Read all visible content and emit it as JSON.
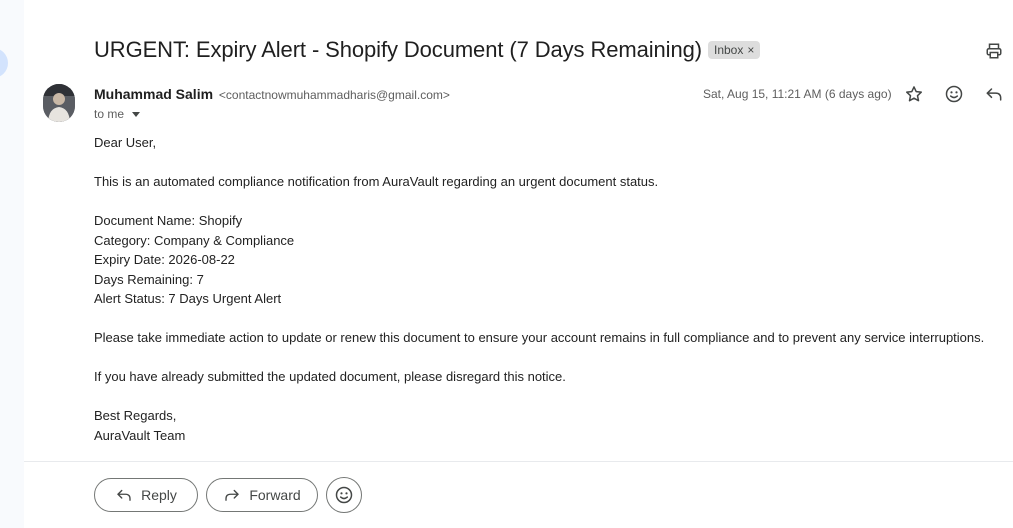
{
  "email": {
    "subject": "URGENT: Expiry Alert - Shopify Document (7 Days Remaining)",
    "label": "Inbox",
    "label_remove": "×",
    "sender_name": "Muhammad Salim",
    "sender_email": "<contactnowmuhammadharis@gmail.com>",
    "recipient": "to me",
    "date": "Sat, Aug 15, 11:21 AM (6 days ago)",
    "body": {
      "greeting": "Dear User,",
      "intro": "This is an automated compliance notification from AuraVault regarding an urgent document status.",
      "doc_name": "Document Name: Shopify",
      "category": "Category: Company & Compliance",
      "expiry": "Expiry Date: 2026-08-22",
      "days": "Days Remaining: 7",
      "status": "Alert Status: 7 Days Urgent Alert",
      "action": "Please take immediate action to update or renew this document to ensure your account remains in full compliance and to prevent any service interruptions.",
      "disregard": "If you have already submitted the updated document, please disregard this notice.",
      "signoff": "Best Regards,",
      "team": "AuraVault Team"
    }
  },
  "actions": {
    "reply_label": "Reply",
    "forward_label": "Forward"
  },
  "icons": {
    "print": "print-icon",
    "star": "star-icon",
    "emoji": "emoji-icon",
    "reply": "reply-icon",
    "forward": "forward-icon"
  },
  "colors": {
    "accent": "#d3e3fd",
    "chip_bg": "#dddddd",
    "text": "#1f1f1f",
    "muted": "#5e5e5e"
  }
}
